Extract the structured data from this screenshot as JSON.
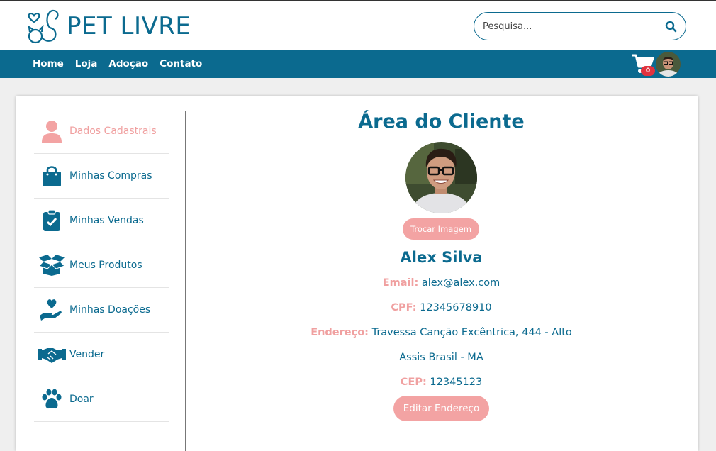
{
  "brand": {
    "name": "PET LIVRE",
    "color": "#0b6a8f",
    "accent": "#f3a3a3"
  },
  "search": {
    "placeholder": "Pesquisa...",
    "icon": "search-icon"
  },
  "nav": {
    "items": [
      "Home",
      "Loja",
      "Adoção",
      "Contato"
    ],
    "cart_count": "0"
  },
  "sidebar": {
    "items": [
      {
        "label": "Dados Cadastrais",
        "icon": "user-icon",
        "active": true
      },
      {
        "label": "Minhas Compras",
        "icon": "shopping-bag-icon"
      },
      {
        "label": "Minhas Vendas",
        "icon": "clipboard-check-icon"
      },
      {
        "label": "Meus Produtos",
        "icon": "open-box-icon"
      },
      {
        "label": "Minhas Doações",
        "icon": "hand-heart-icon"
      },
      {
        "label": "Vender",
        "icon": "handshake-icon"
      },
      {
        "label": "Doar",
        "icon": "paw-icon"
      }
    ]
  },
  "main": {
    "title": "Área do Cliente",
    "change_image": "Trocar Imagem",
    "name": "Alex Silva",
    "email_label": "Email:",
    "email": "alex@alex.com",
    "cpf_label": "CPF:",
    "cpf": "12345678910",
    "address_label": "Endereço:",
    "address_line1": "Travessa Canção Excêntrica, 444 - Alto",
    "address_line2": "Assis Brasil - MA",
    "cep_label": "CEP:",
    "cep": "12345123",
    "edit_address": "Editar Endereço"
  }
}
